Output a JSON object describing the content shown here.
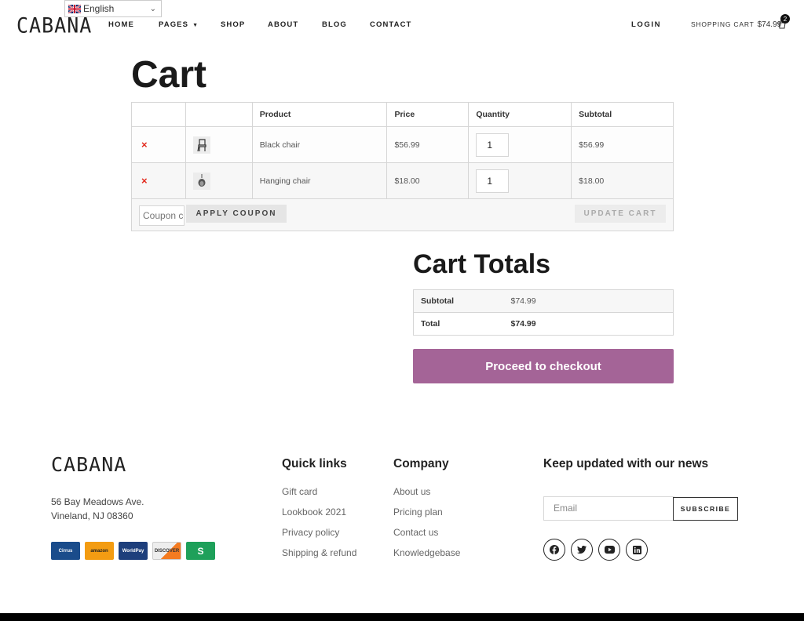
{
  "header": {
    "language": "English",
    "logo": "CABANA",
    "nav": [
      {
        "label": "HOME"
      },
      {
        "label": "PAGES"
      },
      {
        "label": "SHOP"
      },
      {
        "label": "ABOUT"
      },
      {
        "label": "BLOG"
      },
      {
        "label": "CONTACT"
      }
    ],
    "login": "LOGIN",
    "cart_label": "SHOPPING CART",
    "cart_amount": "$74.99",
    "cart_count": "2"
  },
  "cart": {
    "title": "Cart",
    "columns": [
      "",
      "",
      "Product",
      "Price",
      "Quantity",
      "Subtotal"
    ],
    "items": [
      {
        "remove": "×",
        "product": "Black chair",
        "price": "$56.99",
        "quantity": "1",
        "subtotal": "$56.99"
      },
      {
        "remove": "×",
        "product": "Hanging chair",
        "price": "$18.00",
        "quantity": "1",
        "subtotal": "$18.00"
      }
    ],
    "coupon_placeholder": "Coupon code",
    "apply_coupon": "APPLY COUPON",
    "update_cart": "UPDATE CART"
  },
  "totals": {
    "title": "Cart Totals",
    "subtotal_label": "Subtotal",
    "subtotal_value": "$74.99",
    "total_label": "Total",
    "total_value": "$74.99",
    "checkout": "Proceed to checkout"
  },
  "footer": {
    "logo": "CABANA",
    "address_line1": "56 Bay Meadows Ave.",
    "address_line2": "Vineland, NJ 08360",
    "payments": [
      {
        "name": "Cirrus",
        "color": "#1a4c8b"
      },
      {
        "name": "amazon",
        "color": "#f39c12"
      },
      {
        "name": "WorldPay",
        "color": "#1e3f7c"
      },
      {
        "name": "DISCOVER",
        "color": "#eeeeee"
      },
      {
        "name": "S",
        "color": "#1ea05a"
      }
    ],
    "quick_links_title": "Quick links",
    "quick_links": [
      "Gift card",
      "Lookbook 2021",
      "Privacy policy",
      "Shipping & refund"
    ],
    "company_title": "Company",
    "company_links": [
      "About us",
      "Pricing plan",
      "Contact us",
      "Knowledgebase"
    ],
    "news_title": "Keep updated with our news",
    "email_placeholder": "Email",
    "subscribe": "SUBSCRIBE",
    "socials": [
      "facebook-icon",
      "twitter-icon",
      "youtube-icon",
      "linkedin-icon"
    ]
  },
  "colors": {
    "checkout_button": "#a46497",
    "remove": "#e2291c",
    "text": "#222222"
  }
}
